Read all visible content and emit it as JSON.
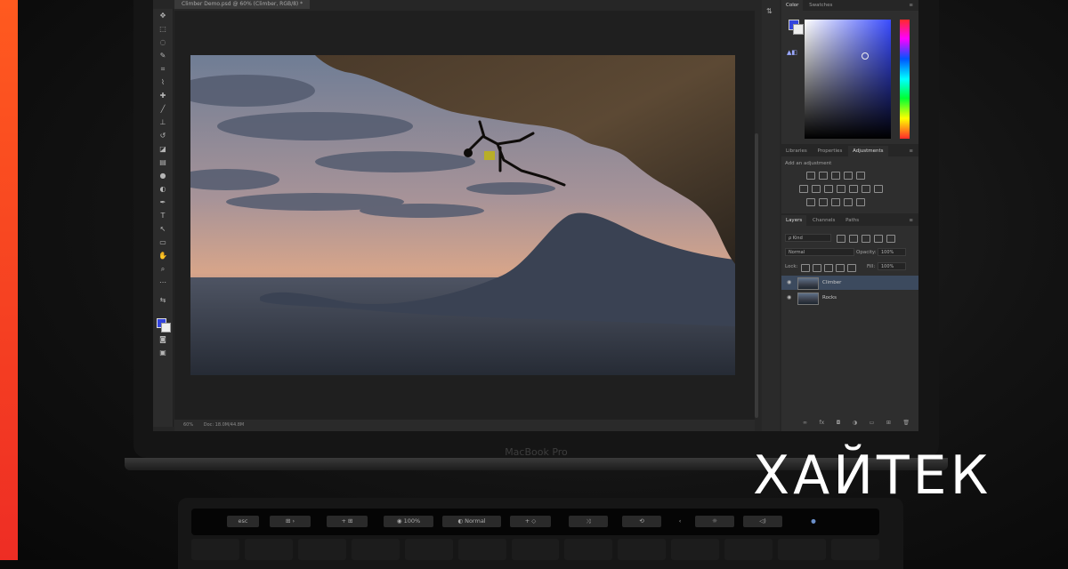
{
  "brand": {
    "logo_text": "ХАЙТЕК",
    "accent_color": "#ee3a24"
  },
  "laptop": {
    "model_label": "MacBook Pro"
  },
  "document": {
    "tab_title": "Climber Demo.psd @ 60% (Climber, RGB/8) *"
  },
  "status_bar": {
    "zoom": "60%",
    "doc_size": "Doc: 18.0M/44.8M"
  },
  "panels": {
    "color": {
      "tabs": [
        "Color",
        "Swatches"
      ],
      "fg": "#3344dd",
      "bg": "#eeeeee"
    },
    "adjustments": {
      "tabs": [
        "Libraries",
        "Properties",
        "Adjustments"
      ],
      "hint": "Add an adjustment"
    },
    "layers": {
      "tabs": [
        "Layers",
        "Channels",
        "Paths"
      ],
      "kind_filter": "ρ Kind",
      "blend_mode": "Normal",
      "opacity_label": "Opacity:",
      "opacity_value": "100%",
      "lock_label": "Lock:",
      "fill_label": "Fill:",
      "fill_value": "100%",
      "items": [
        {
          "name": "Climber",
          "selected": true
        },
        {
          "name": "Rocks",
          "selected": false
        }
      ]
    }
  },
  "touch_bar": {
    "buttons": [
      "esc",
      "⊞ ›",
      "+ ⊞",
      "◉ 100%",
      "◐ Normal",
      "+ ◇",
      "⤨",
      "⟲",
      "‹",
      "☼",
      "◁)",
      "●"
    ]
  }
}
